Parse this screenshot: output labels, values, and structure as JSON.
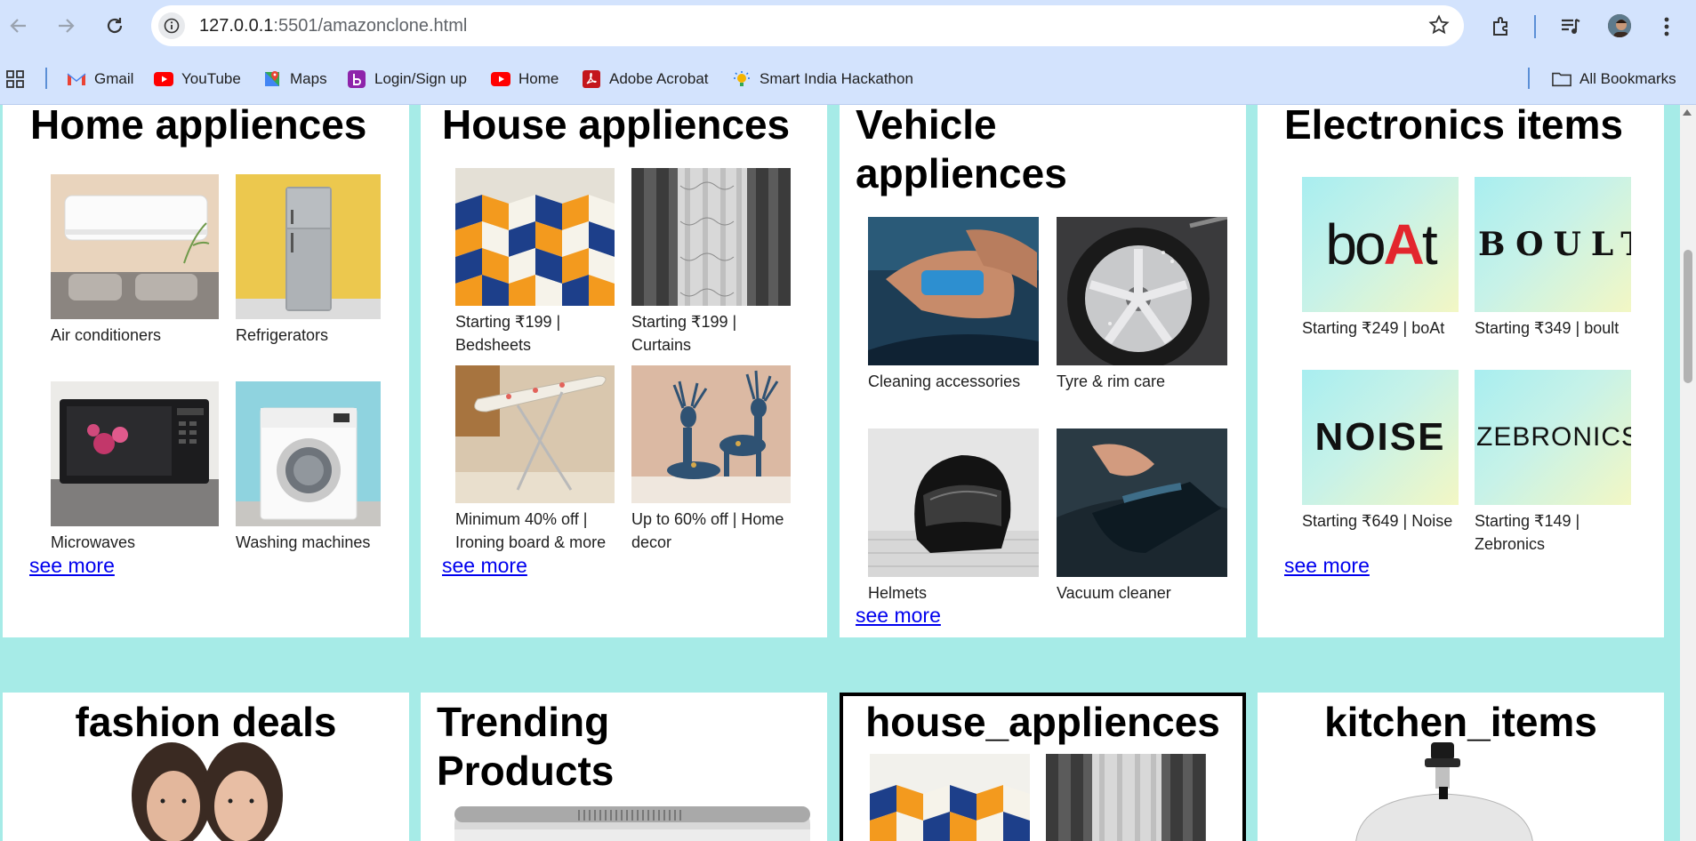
{
  "browser": {
    "url_host": "127.0.0.1",
    "url_rest": ":5501/amazonclone.html",
    "bookmarks": [
      {
        "label": "Gmail",
        "icon": "gmail-icon"
      },
      {
        "label": "YouTube",
        "icon": "youtube-icon"
      },
      {
        "label": "Maps",
        "icon": "maps-icon"
      },
      {
        "label": "Login/Sign up",
        "icon": "bookmark-b-icon"
      },
      {
        "label": "Home",
        "icon": "youtube-icon"
      },
      {
        "label": "Adobe Acrobat",
        "icon": "acrobat-icon"
      },
      {
        "label": "Smart India Hackathon",
        "icon": "sih-icon"
      }
    ],
    "all_bookmarks": "All Bookmarks"
  },
  "cards": [
    {
      "title": "Home appliences",
      "items": [
        {
          "caption": "Air conditioners",
          "image": "air-conditioner"
        },
        {
          "caption": "Refrigerators",
          "image": "refrigerator"
        },
        {
          "caption": "Microwaves",
          "image": "microwave"
        },
        {
          "caption": "Washing machines",
          "image": "washing-machine"
        }
      ],
      "see_more": "see more"
    },
    {
      "title": "House appliences",
      "items": [
        {
          "caption": "Starting ₹199 | Bedsheets",
          "image": "bedsheet"
        },
        {
          "caption": "Starting ₹199 | Curtains",
          "image": "curtain"
        },
        {
          "caption": "Minimum 40% off | Ironing board & more",
          "image": "ironing-board"
        },
        {
          "caption": "Up to 60% off | Home decor",
          "image": "deer-decor"
        }
      ],
      "see_more": "see more"
    },
    {
      "title_line1": "Vehicle",
      "title_line2": "appliences",
      "items": [
        {
          "caption": "Cleaning accessories",
          "image": "car-cleaning"
        },
        {
          "caption": "Tyre & rim care",
          "image": "tyre-rim"
        },
        {
          "caption": "Helmets",
          "image": "helmet"
        },
        {
          "caption": "Vacuum cleaner",
          "image": "vacuum"
        }
      ],
      "see_more": "see more"
    },
    {
      "title": "Electronics items",
      "items": [
        {
          "caption": "Starting ₹249 | boAt",
          "brand": "boAt"
        },
        {
          "caption": "Starting ₹349 | boult",
          "brand": "BOULT"
        },
        {
          "caption": "Starting ₹649 | Noise",
          "brand": "NOISE"
        },
        {
          "caption": "Starting ₹149 | Zebronics",
          "brand": "ZEBRONICS"
        }
      ],
      "see_more": "see more"
    }
  ],
  "row2": [
    {
      "title": "fashion deals"
    },
    {
      "title_line1": "Trending",
      "title_line2": "Products"
    },
    {
      "title": "house_appliences"
    },
    {
      "title": "kitchen_items"
    }
  ]
}
